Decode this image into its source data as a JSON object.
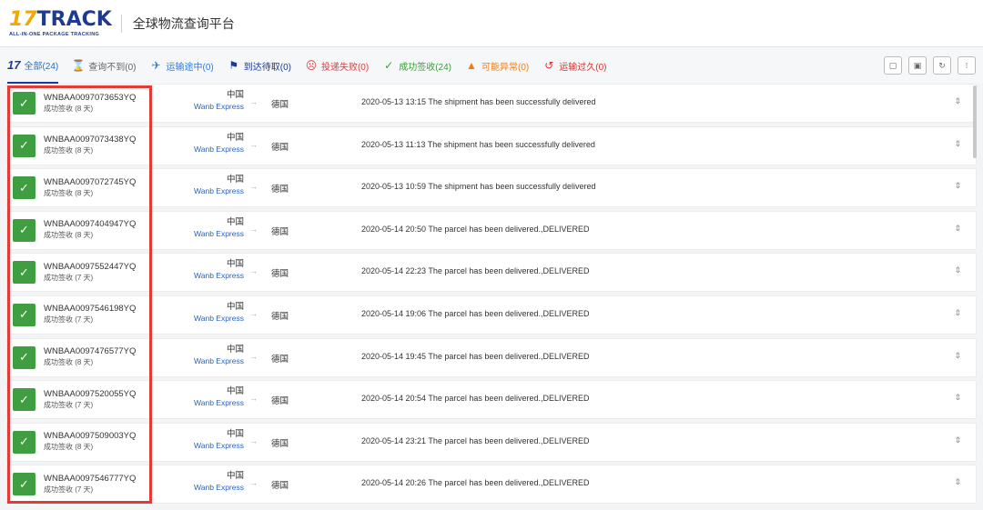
{
  "header": {
    "logo_main_17": "17",
    "logo_main_track": "TRACK",
    "logo_sub": "ALL-IN-ONE PACKAGE TRACKING",
    "title": "全球物流查询平台"
  },
  "tabs": [
    {
      "key": "all",
      "icon": "17",
      "label": "全部(24)"
    },
    {
      "key": "notfound",
      "icon": "hourglass-icon",
      "label": "查询不到(0)"
    },
    {
      "key": "transit",
      "icon": "airplane-icon",
      "label": "运输途中(0)"
    },
    {
      "key": "pickup",
      "icon": "flag-icon",
      "label": "到达待取(0)"
    },
    {
      "key": "failed",
      "icon": "sad-face-icon",
      "label": "投递失败(0)"
    },
    {
      "key": "delivered",
      "icon": "checkmark-icon",
      "label": "成功签收(24)"
    },
    {
      "key": "exception",
      "icon": "warning-icon",
      "label": "可能异常(0)"
    },
    {
      "key": "expired",
      "icon": "history-icon",
      "label": "运输过久(0)"
    }
  ],
  "rows": [
    {
      "number": "WNBAA0097073653YQ",
      "status": "成功签收 (8 天)",
      "origin": "中国",
      "carrier": "Wanb Express",
      "dest": "德国",
      "event": "2020-05-13 13:15  The shipment has been successfully delivered"
    },
    {
      "number": "WNBAA0097073438YQ",
      "status": "成功签收 (8 天)",
      "origin": "中国",
      "carrier": "Wanb Express",
      "dest": "德国",
      "event": "2020-05-13 11:13  The shipment has been successfully delivered"
    },
    {
      "number": "WNBAA0097072745YQ",
      "status": "成功签收 (8 天)",
      "origin": "中国",
      "carrier": "Wanb Express",
      "dest": "德国",
      "event": "2020-05-13 10:59  The shipment has been successfully delivered"
    },
    {
      "number": "WNBAA0097404947YQ",
      "status": "成功签收 (8 天)",
      "origin": "中国",
      "carrier": "Wanb Express",
      "dest": "德国",
      "event": "2020-05-14 20:50  The parcel has been delivered.,DELIVERED"
    },
    {
      "number": "WNBAA0097552447YQ",
      "status": "成功签收 (7 天)",
      "origin": "中国",
      "carrier": "Wanb Express",
      "dest": "德国",
      "event": "2020-05-14 22:23  The parcel has been delivered.,DELIVERED"
    },
    {
      "number": "WNBAA0097546198YQ",
      "status": "成功签收 (7 天)",
      "origin": "中国",
      "carrier": "Wanb Express",
      "dest": "德国",
      "event": "2020-05-14 19:06  The parcel has been delivered.,DELIVERED"
    },
    {
      "number": "WNBAA0097476577YQ",
      "status": "成功签收 (8 天)",
      "origin": "中国",
      "carrier": "Wanb Express",
      "dest": "德国",
      "event": "2020-05-14 19:45  The parcel has been delivered.,DELIVERED"
    },
    {
      "number": "WNBAA0097520055YQ",
      "status": "成功签收 (7 天)",
      "origin": "中国",
      "carrier": "Wanb Express",
      "dest": "德国",
      "event": "2020-05-14 20:54  The parcel has been delivered.,DELIVERED"
    },
    {
      "number": "WNBAA0097509003YQ",
      "status": "成功签收 (8 天)",
      "origin": "中国",
      "carrier": "Wanb Express",
      "dest": "德国",
      "event": "2020-05-14 23:21  The parcel has been delivered.,DELIVERED"
    },
    {
      "number": "WNBAA0097546777YQ",
      "status": "成功签收 (7 天)",
      "origin": "中国",
      "carrier": "Wanb Express",
      "dest": "德国",
      "event": "2020-05-14 20:26  The parcel has been delivered.,DELIVERED"
    }
  ],
  "colors": {
    "brand_blue": "#1f3a93",
    "brand_yellow": "#f2a800",
    "delivered_green": "#3f9d42",
    "highlight_red": "#e53935"
  }
}
